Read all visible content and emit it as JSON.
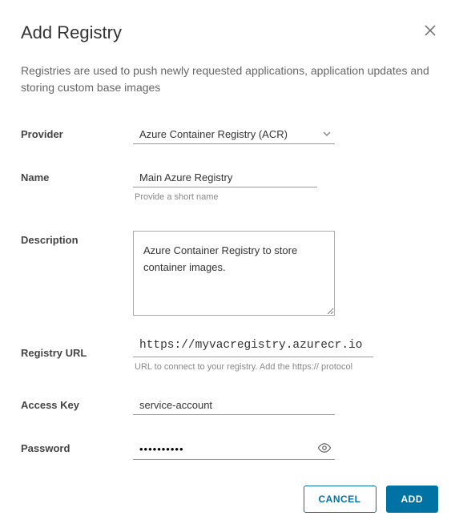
{
  "dialog": {
    "title": "Add Registry",
    "subtitle": "Registries are used to push newly requested applications, application updates and storing custom base images"
  },
  "fields": {
    "provider": {
      "label": "Provider",
      "value": "Azure Container Registry (ACR)"
    },
    "name": {
      "label": "Name",
      "value": "Main Azure Registry",
      "helper": "Provide a short name"
    },
    "description": {
      "label": "Description",
      "value": "Azure Container Registry to store container images."
    },
    "registry_url": {
      "label": "Registry URL",
      "value": "https://myvacregistry.azurecr.io",
      "helper": "URL to connect to your registry. Add the https:// protocol"
    },
    "access_key": {
      "label": "Access Key",
      "value": "service-account"
    },
    "password": {
      "label": "Password",
      "value": "••••••••••"
    }
  },
  "buttons": {
    "cancel": "CANCEL",
    "add": "ADD"
  }
}
